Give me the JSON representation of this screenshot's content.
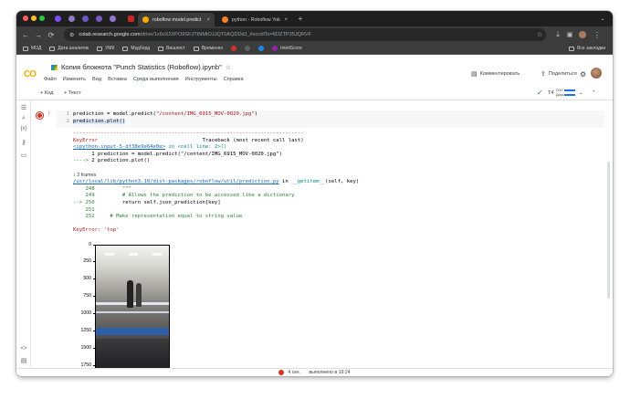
{
  "browser": {
    "tabs": [
      {
        "label": "roboflow model.predict save",
        "active": true
      },
      {
        "label": "python - Roboflow Yolo: how",
        "active": false
      }
    ],
    "url_host": "colab.research.google.com",
    "url_path": "/drive/1x6vX2XPO9SFJTtNMtOJJQT0AQDDdJ_#scrollTo=6DZTP35JQRVF",
    "bookmarks": [
      "МОД",
      "Дата аналитик",
      "УМК",
      "Мудборд",
      "Вишлист",
      "Временно",
      "InteliScore"
    ],
    "all_bookmarks": "Все закладки"
  },
  "colab": {
    "logo": "CO",
    "notebook_title": "Копия блокнота \"Punch Statistics (Roboflow).ipynb\"",
    "menu": [
      "Файл",
      "Изменить",
      "Вид",
      "Вставка",
      "Среда выполнения",
      "Инструменты",
      "Справка"
    ],
    "comments_label": "Комментировать",
    "share_label": "Поделиться",
    "add_code": "+ Код",
    "add_text": "+ Текст",
    "ram_label": "ОЗУ",
    "disk_label": "Диск",
    "ram_prefix": "T4"
  },
  "cell": {
    "lines": [
      {
        "n": "1",
        "pre": "prediction = model.predict(",
        "str": "\"/content/IMG_6915_MOV-0020.jpg\"",
        "post": ")"
      },
      {
        "n": "2",
        "pre": "prediction.plot()",
        "str": "",
        "post": ""
      }
    ]
  },
  "output": {
    "separator": "---------------------------------------------------------------------------",
    "error_name": "KeyError",
    "traceback_header": "Traceback (most recent call last)",
    "ipython_link": "<ipython-input-5-df38e9e64e0e>",
    "in_text": " in <cell line: 2>()",
    "ctx1": "      1 prediction = model.predict(\"/content/IMG_6915_MOV-0020.jpg\")",
    "ctx2_arrow": "----> ",
    "ctx2": "2 prediction.plot()",
    "frames_label": "2 frames",
    "file_link": "/usr/local/lib/python3.10/dist-packages/roboflow/util/prediction.py",
    "file_in": " in ",
    "func": "__getitem__",
    "func_args": "(self, key)",
    "l248": "    248         \"\"\"",
    "l249": "    249         # Allows the prediction to be accessed like a dictionary",
    "l250_arrow": "--> 250",
    "l250": "         return self.json_prediction[key]",
    "l251": "    251",
    "l252": "    252     # Make representation equal to string value",
    "final_error": "KeyError: 'top'"
  },
  "plot": {
    "y_ticks": [
      "0",
      "250",
      "500",
      "750",
      "1000",
      "1250",
      "1500",
      "1750"
    ]
  },
  "status": {
    "seconds": "4 сек.",
    "finished": "выполнено в 19:24"
  }
}
